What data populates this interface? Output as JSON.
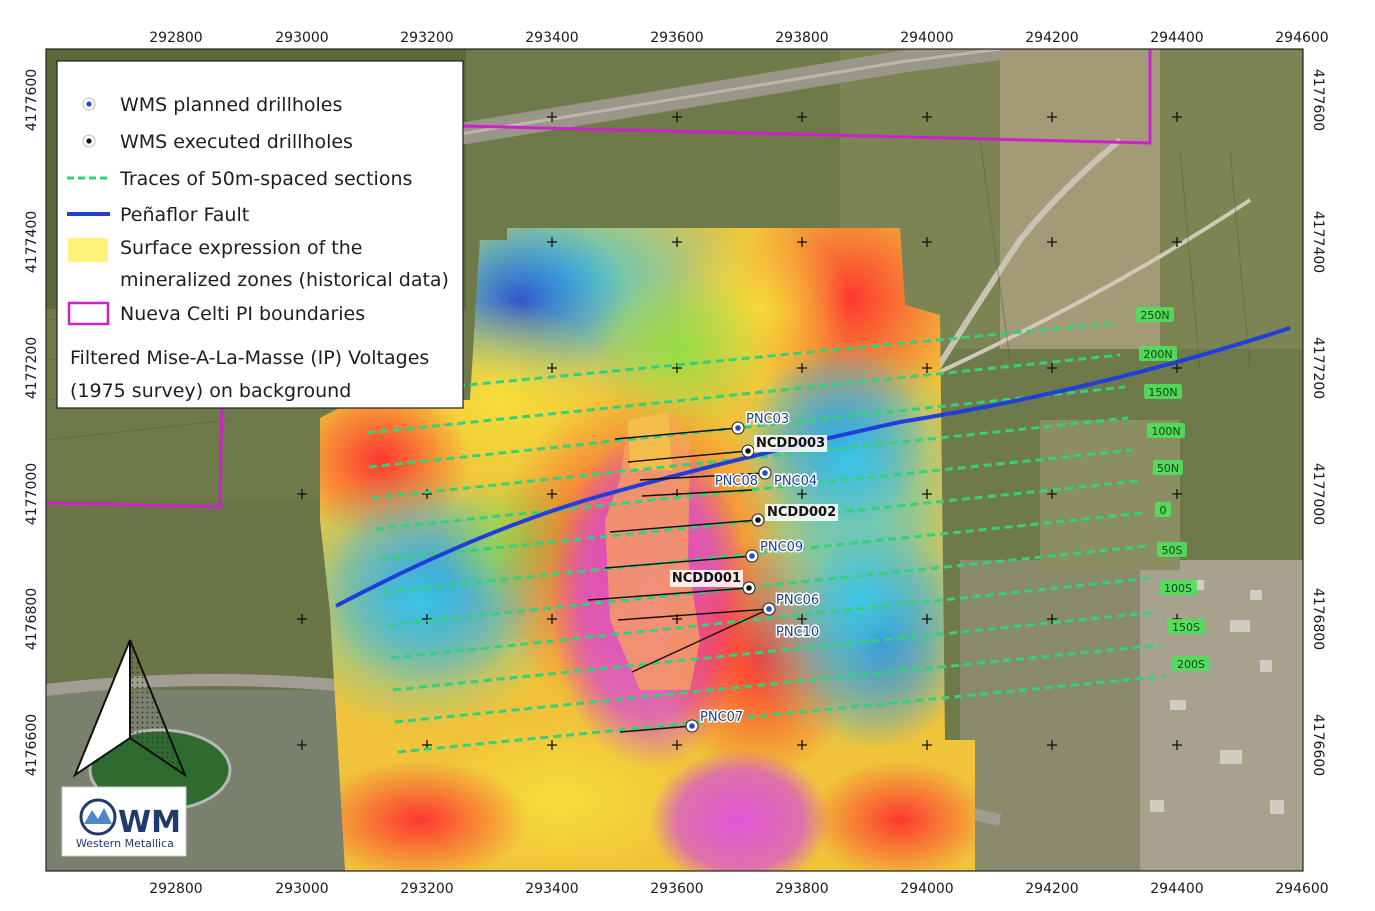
{
  "map": {
    "top_ticks": [
      "292800",
      "293000",
      "293200",
      "293400",
      "293600",
      "293800",
      "294000",
      "294200",
      "294400",
      "294600"
    ],
    "bottom_ticks": [
      "292800",
      "293000",
      "293200",
      "293400",
      "293600",
      "293800",
      "294000",
      "294200",
      "294400",
      "294600"
    ],
    "left_ticks": [
      "4177600",
      "4177400",
      "4177200",
      "4177000",
      "4176800",
      "4176600"
    ],
    "right_ticks": [
      "4177600",
      "4177400",
      "4177200",
      "4177000",
      "4176800",
      "4176600"
    ]
  },
  "legend": {
    "planned": "WMS planned drillholes",
    "executed": "WMS executed drillholes",
    "traces": "Traces of 50m-spaced sections",
    "fault": "Peñaflor Fault",
    "surface1": "Surface expression of the",
    "surface2": "mineralized zones (historical data)",
    "boundaries": "Nueva Celti PI boundaries",
    "note1": "Filtered Mise-A-La-Masse (IP) Voltages",
    "note2": "(1975 survey) on background",
    "colors": {
      "planned": "#1f4fd6",
      "executed": "#111111",
      "traces": "#33d17a",
      "fault": "#1f3fd8",
      "surface": "#fff27a",
      "boundaries": "#cc22cc"
    }
  },
  "drillholes": [
    {
      "name": "PNC03",
      "kind": "planned"
    },
    {
      "name": "NCDD003",
      "kind": "executed"
    },
    {
      "name": "PNC08",
      "kind": "planned"
    },
    {
      "name": "PNC04",
      "kind": "planned"
    },
    {
      "name": "NCDD002",
      "kind": "executed"
    },
    {
      "name": "PNC09",
      "kind": "planned"
    },
    {
      "name": "NCDD001",
      "kind": "executed"
    },
    {
      "name": "PNC06",
      "kind": "planned"
    },
    {
      "name": "PNC10",
      "kind": "planned"
    },
    {
      "name": "PNC07",
      "kind": "planned"
    }
  ],
  "section_labels": [
    "250N",
    "200N",
    "150N",
    "100N",
    "50N",
    "0",
    "50S",
    "100S",
    "150S",
    "200S"
  ],
  "logo": {
    "text": "WM",
    "subtitle": "Western Metallica"
  }
}
